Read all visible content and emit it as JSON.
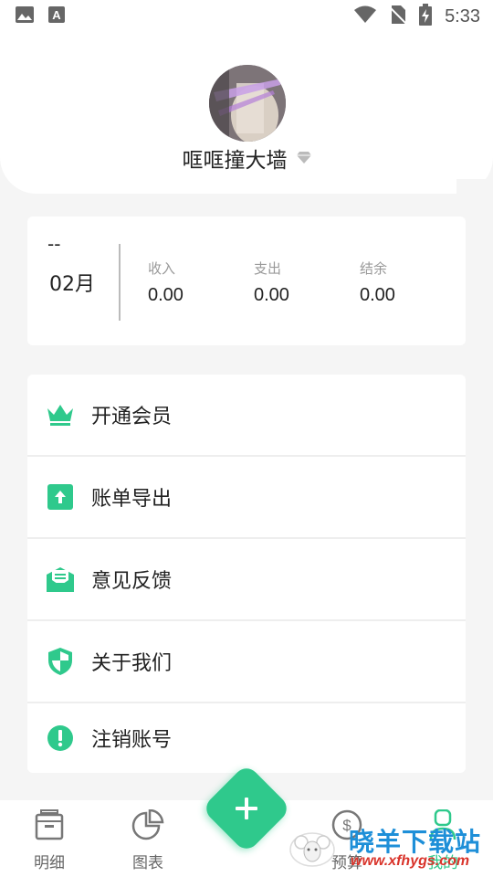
{
  "status_bar": {
    "time": "5:33",
    "icons": [
      "image-icon",
      "text-a-icon",
      "wifi-icon",
      "no-sim-icon",
      "battery-charging-icon"
    ]
  },
  "profile": {
    "username": "哐哐撞大墙",
    "badge_icon": "diamond-icon"
  },
  "summary": {
    "year": "--",
    "month": "02月",
    "columns": [
      {
        "label": "收入",
        "value": "0.00"
      },
      {
        "label": "支出",
        "value": "0.00"
      },
      {
        "label": "结余",
        "value": "0.00"
      }
    ]
  },
  "menu": {
    "items": [
      {
        "label": "开通会员",
        "icon": "crown-icon"
      },
      {
        "label": "账单导出",
        "icon": "export-icon"
      },
      {
        "label": "意见反馈",
        "icon": "feedback-mail-icon"
      },
      {
        "label": "关于我们",
        "icon": "shield-icon"
      },
      {
        "label": "注销账号",
        "icon": "exclamation-icon"
      }
    ]
  },
  "bottom_nav": {
    "items": [
      {
        "label": "明细",
        "icon": "detail-box-icon"
      },
      {
        "label": "图表",
        "icon": "pie-chart-icon"
      },
      {
        "label": "预算",
        "icon": "budget-coin-icon"
      },
      {
        "label": "我的",
        "icon": "profile-icon"
      }
    ],
    "add_icon": "plus-icon"
  },
  "watermark": {
    "text": "晓羊下载站",
    "url": "www.xfhygs.com"
  },
  "colors": {
    "accent": "#2fc98c",
    "background": "#f5f5f5",
    "card": "#ffffff"
  }
}
